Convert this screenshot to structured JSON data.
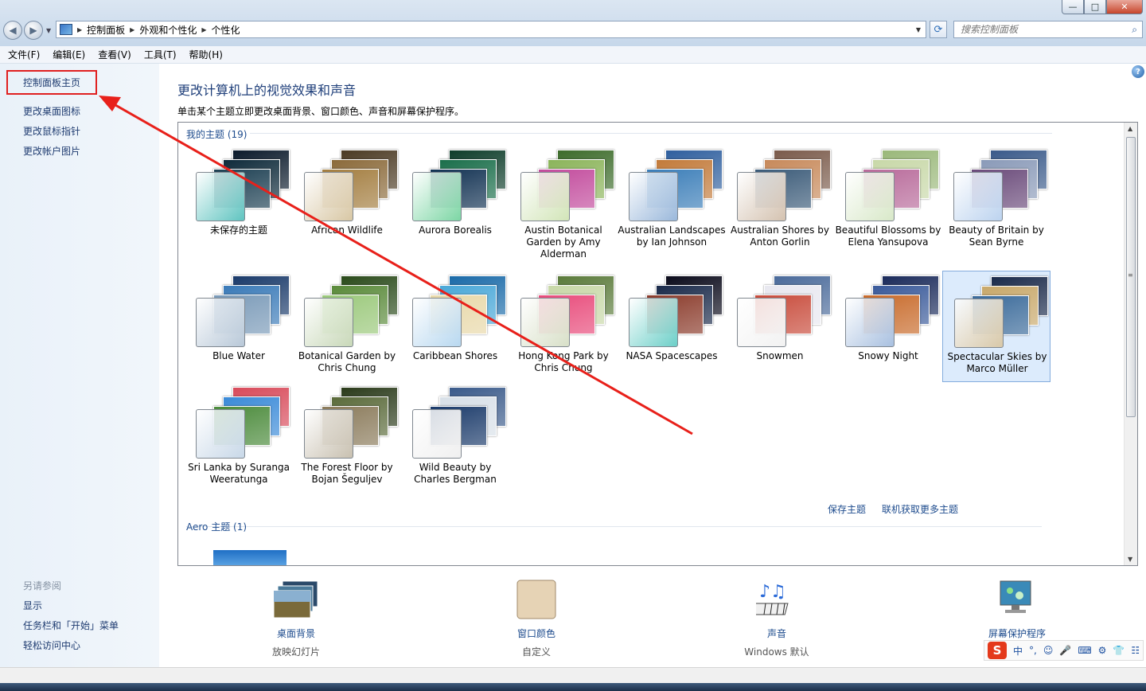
{
  "window": {
    "buttons": {
      "minimize": "—",
      "maximize": "□",
      "close": "✕"
    }
  },
  "address": {
    "crumbs": [
      "控制面板",
      "外观和个性化",
      "个性化"
    ],
    "search_placeholder": "搜索控制面板"
  },
  "menu": [
    "文件(F)",
    "编辑(E)",
    "查看(V)",
    "工具(T)",
    "帮助(H)"
  ],
  "sidebar": {
    "home": "控制面板主页",
    "links": [
      "更改桌面图标",
      "更改鼠标指针",
      "更改帐户图片"
    ],
    "see_also_title": "另请参阅",
    "see_also": [
      "显示",
      "任务栏和「开始」菜单",
      "轻松访问中心"
    ]
  },
  "main": {
    "title": "更改计算机上的视觉效果和声音",
    "subtitle": "单击某个主题立即更改桌面背景、窗口颜色、声音和屏幕保护程序。",
    "my_themes_header": "我的主题 (19)",
    "aero_header": "Aero 主题 (1)",
    "save_theme": "保存主题",
    "get_more": "联机获取更多主题",
    "themes": [
      {
        "label": "未保存的主题",
        "glass": "#5fc4c0",
        "cards": [
          "#0b1a2b",
          "#0e2a3a",
          "#1c3f52"
        ],
        "selected": false
      },
      {
        "label": "African Wildlife",
        "glass": "#d8c7a4",
        "cards": [
          "#4b3a23",
          "#8b6a3a",
          "#a37d3f"
        ],
        "selected": false
      },
      {
        "label": "Aurora Borealis",
        "glass": "#7cd6a4",
        "cards": [
          "#0e3d2a",
          "#1a6e4a",
          "#113152"
        ],
        "selected": false
      },
      {
        "label": "Austin Botanical Garden by Amy Alderman",
        "glass": "#d2e5b8",
        "cards": [
          "#3c6b2a",
          "#8bb45a",
          "#c24a9c"
        ],
        "selected": false
      },
      {
        "label": "Australian Landscapes by Ian Johnson",
        "glass": "#9ab8db",
        "cards": [
          "#2f5f9e",
          "#c27a3a",
          "#3a7db8"
        ],
        "selected": false
      },
      {
        "label": "Australian Shores by Anton Gorlin",
        "glass": "#d4c2b0",
        "cards": [
          "#7a5a4a",
          "#c7895a",
          "#3a5a78"
        ],
        "selected": false
      },
      {
        "label": "Beautiful Blossoms by Elena Yansupova",
        "glass": "#d8e8c8",
        "cards": [
          "#9ab87a",
          "#c8d8a8",
          "#b86a9a"
        ],
        "selected": false
      },
      {
        "label": "Beauty of Britain by Sean Byrne",
        "glass": "#bcd3ef",
        "cards": [
          "#3a5a8a",
          "#8a9ab8",
          "#6a4a7a"
        ],
        "selected": false
      },
      {
        "label": "Blue Water",
        "glass": "#b8c8d8",
        "cards": [
          "#1a3a6a",
          "#3a7ab8",
          "#7a9ab8"
        ],
        "selected": false
      },
      {
        "label": "Botanical Garden by Chris Chung",
        "glass": "#c8d8b8",
        "cards": [
          "#2a4a1a",
          "#5a8a3a",
          "#9ac87a"
        ],
        "selected": false
      },
      {
        "label": "Caribbean Shores",
        "glass": "#b8d8f0",
        "cards": [
          "#1a6aa8",
          "#4aa8d8",
          "#e8d8a8"
        ],
        "selected": false
      },
      {
        "label": "Hong Kong Park by Chris Chung",
        "glass": "#d8e0c8",
        "cards": [
          "#5a7a3a",
          "#c8d8a8",
          "#e84a7a"
        ],
        "selected": false
      },
      {
        "label": "NASA Spacescapes",
        "glass": "#6ccfc8",
        "cards": [
          "#0a0a1a",
          "#1a2a4a",
          "#8a3a2a"
        ],
        "selected": false
      },
      {
        "label": "Snowmen",
        "glass": "#f2f2f2",
        "cards": [
          "#4a6a9a",
          "#e8e8f0",
          "#c84a3a"
        ],
        "selected": false
      },
      {
        "label": "Snowy Night",
        "glass": "#a8c0e0",
        "cards": [
          "#1a2a5a",
          "#3a5a9a",
          "#c86a2a"
        ],
        "selected": false
      },
      {
        "label": "Spectacular Skies by Marco Müller",
        "glass": "#d8c8a8",
        "cards": [
          "#1a2a4a",
          "#c8a86a",
          "#3a6a9a"
        ],
        "selected": true
      },
      {
        "label": "Sri Lanka by Suranga Weeratunga",
        "glass": "#c8d8e8",
        "cards": [
          "#d84a5a",
          "#3a8ad8",
          "#4a8a3a"
        ],
        "selected": false
      },
      {
        "label": "The Forest Floor by Bojan Šeguljev",
        "glass": "#c8c0b0",
        "cards": [
          "#2a3a1a",
          "#5a6a3a",
          "#8a7a5a"
        ],
        "selected": false
      },
      {
        "label": "Wild Beauty by Charles Bergman",
        "glass": "#f0f0f0",
        "cards": [
          "#3a5a8a",
          "#d8e0e8",
          "#1a3a6a"
        ],
        "selected": false
      }
    ]
  },
  "bottom": [
    {
      "name": "桌面背景",
      "value": "放映幻灯片"
    },
    {
      "name": "窗口颜色",
      "value": "自定义"
    },
    {
      "name": "声音",
      "value": "Windows 默认"
    },
    {
      "name": "屏幕保护程序",
      "value": ""
    }
  ],
  "ime": {
    "logo": "S",
    "lang": "中",
    "punct": "°,"
  }
}
